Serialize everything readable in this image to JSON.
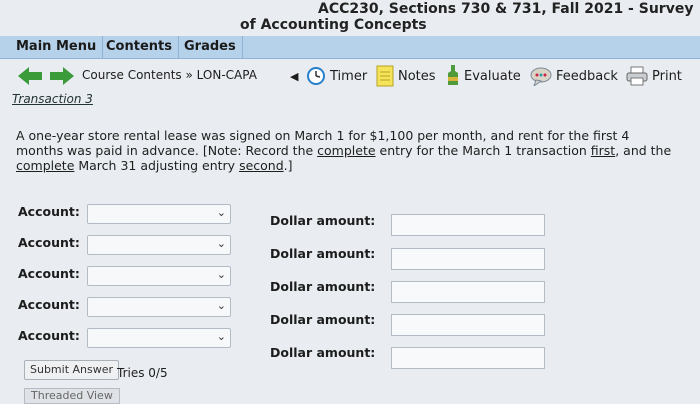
{
  "header": {
    "line1": "ACC230, Sections 730 & 731, Fall 2021 - Survey",
    "line2": "of Accounting Concepts"
  },
  "menu": [
    "Main Menu",
    "Contents",
    "Grades"
  ],
  "nav": {
    "breadcrumb": "Course Contents » LON-CAPA",
    "tools": [
      "Timer",
      "Notes",
      "Evaluate",
      "Feedback",
      "Print"
    ]
  },
  "problem": {
    "title": "Transaction 3",
    "text_part1": "A one-year store rental lease was signed on March 1 for $1,100 per month, and rent for the first 4 months was paid in advance.  [Note: Record the ",
    "text_u1": "complete",
    "text_part2": " entry for the March 1 transaction ",
    "text_u2": "first",
    "text_part3": ", and the ",
    "text_u3": "complete",
    "text_part4": " March 31 adjusting entry ",
    "text_u4": "second",
    "text_part5": ".]"
  },
  "form": {
    "account_label": "Account:",
    "amount_label": "Dollar amount:",
    "rows": [
      {
        "account": "",
        "amount": ""
      },
      {
        "account": "",
        "amount": ""
      },
      {
        "account": "",
        "amount": ""
      },
      {
        "account": "",
        "amount": ""
      },
      {
        "account": "",
        "amount": ""
      }
    ],
    "submit_label": "Submit Answer",
    "tries": "Tries 0/5",
    "threaded": "Threaded View"
  },
  "icons": [
    "back-arrow-icon",
    "forward-arrow-icon",
    "timer-icon",
    "notes-icon",
    "evaluate-icon",
    "feedback-icon",
    "print-icon"
  ],
  "colors": {
    "menubar": "#b6d1ea",
    "arrow": "#3b9b3b",
    "background": "#e9edf1"
  }
}
